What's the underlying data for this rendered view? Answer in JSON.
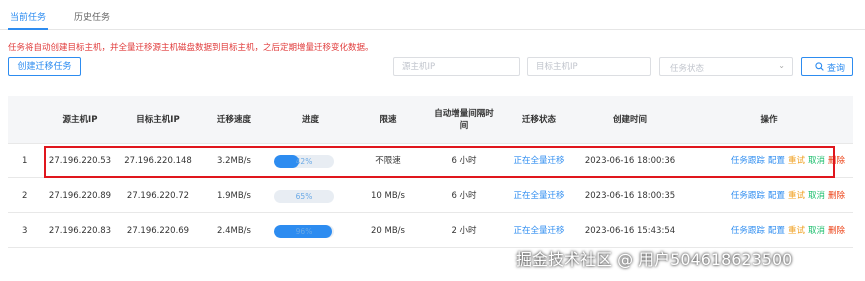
{
  "tabs": [
    {
      "label": "当前任务",
      "active": true
    },
    {
      "label": "历史任务",
      "active": false
    }
  ],
  "notice": "任务将自动创建目标主机，并全量迁移源主机磁盘数据到目标主机，之后定期增量迁移变化数据。",
  "toolbar": {
    "create_label": "创建迁移任务",
    "source_ip_placeholder": "源主机IP",
    "target_ip_placeholder": "目标主机IP",
    "status_placeholder": "任务状态",
    "search_label": "查询"
  },
  "table": {
    "headers": [
      "",
      "源主机IP",
      "目标主机IP",
      "迁移速度",
      "进度",
      "限速",
      "自动增量间隔时间",
      "迁移状态",
      "创建时间",
      "操作"
    ],
    "rows": [
      {
        "idx": "1",
        "src": "27.196.220.53",
        "dst": "27.196.220.148",
        "speed": "3.2MB/s",
        "progress": 42,
        "progress_label": "42%",
        "limit": "不限速",
        "interval": "6 小时",
        "status": "正在全量迁移",
        "created": "2023-06-16 18:00:36"
      },
      {
        "idx": "2",
        "src": "27.196.220.89",
        "dst": "27.196.220.72",
        "speed": "1.9MB/s",
        "progress": 0,
        "progress_label": "65%",
        "limit": "10 MB/s",
        "interval": "6 小时",
        "status": "正在全量迁移",
        "created": "2023-06-16 18:00:35"
      },
      {
        "idx": "3",
        "src": "27.196.220.83",
        "dst": "27.196.220.69",
        "speed": "2.4MB/s",
        "progress": 96,
        "progress_label": "96%",
        "limit": "20 MB/s",
        "interval": "2 小时",
        "status": "正在全量迁移",
        "created": "2023-06-16 15:43:54"
      }
    ],
    "ops": [
      "任务跟踪",
      "配置",
      "重试",
      "取消",
      "删除"
    ]
  },
  "watermark": "掘金技术社区 @ 用户504618623500"
}
